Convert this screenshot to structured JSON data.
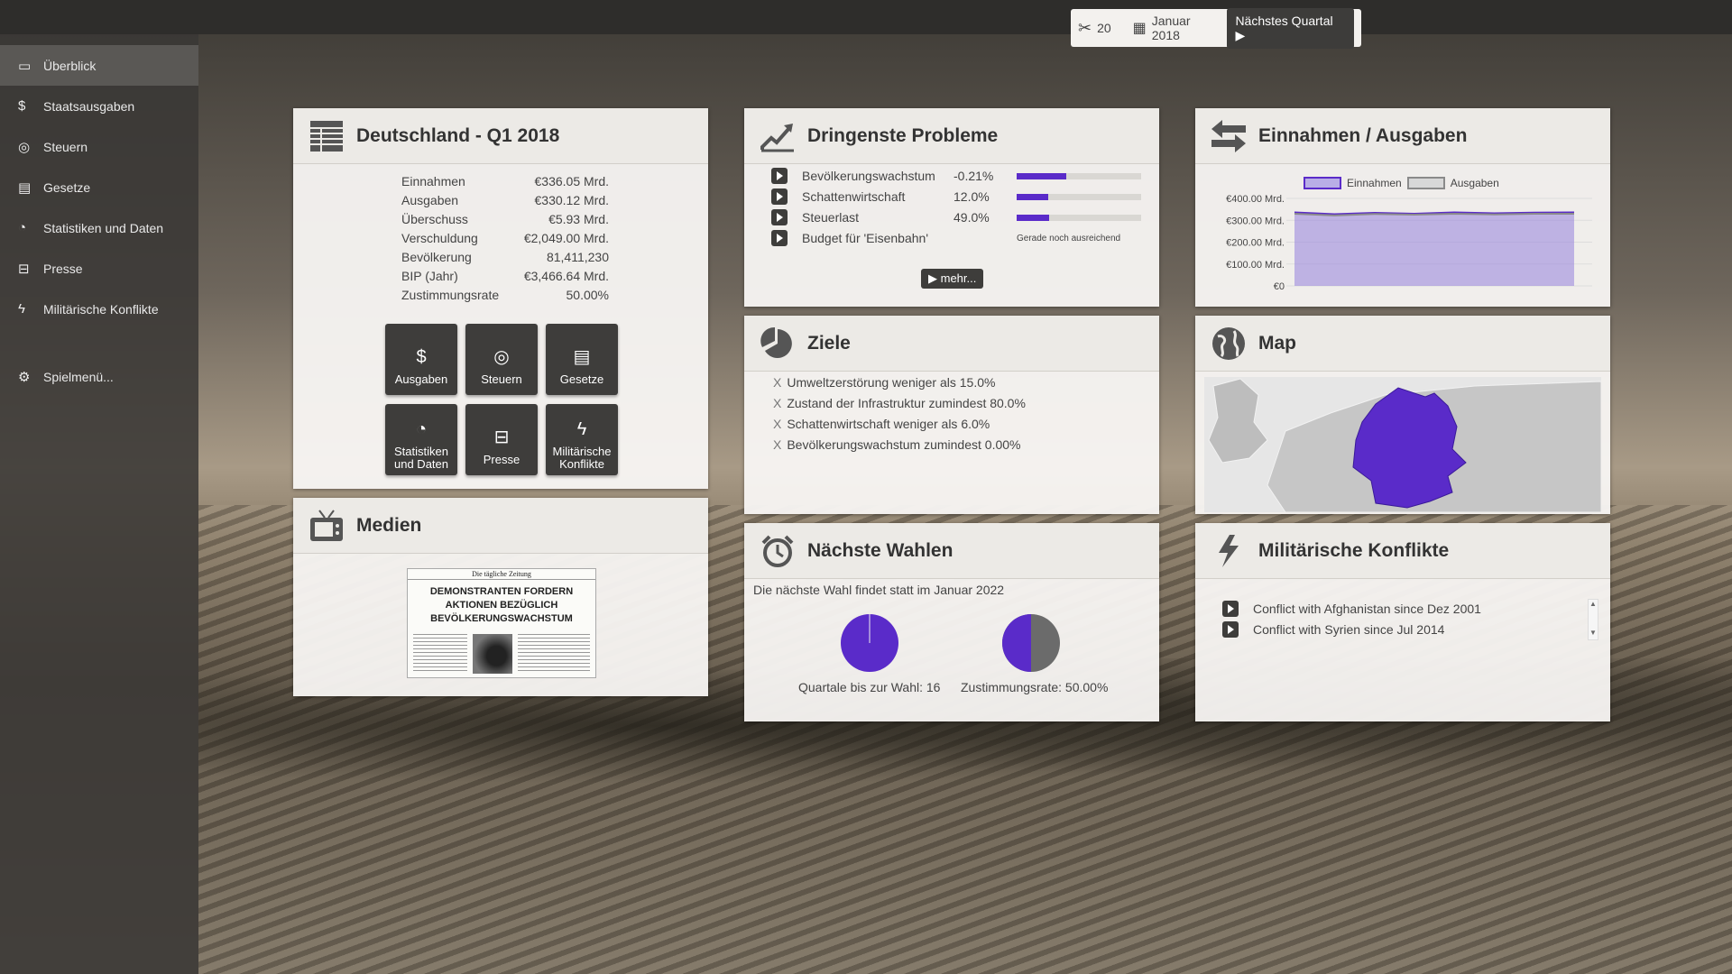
{
  "status": {
    "count": "20",
    "date": "Januar 2018",
    "next_label": "Nächstes Quartal"
  },
  "sidebar": {
    "items": [
      {
        "label": "Überblick",
        "icon": "monitor-icon"
      },
      {
        "label": "Staatsausgaben",
        "icon": "dollar-icon"
      },
      {
        "label": "Steuern",
        "icon": "coin-icon"
      },
      {
        "label": "Gesetze",
        "icon": "book-icon"
      },
      {
        "label": "Statistiken und Daten",
        "icon": "pie-icon"
      },
      {
        "label": "Presse",
        "icon": "newspaper-icon"
      },
      {
        "label": "Militärische Konflikte",
        "icon": "lightning-icon"
      }
    ],
    "menu_label": "Spielmenü..."
  },
  "country": {
    "title": "Deutschland - Q1 2018",
    "stats": [
      {
        "label": "Einnahmen",
        "value": "€336.05 Mrd."
      },
      {
        "label": "Ausgaben",
        "value": "€330.12 Mrd."
      },
      {
        "label": "Überschuss",
        "value": "€5.93 Mrd."
      },
      {
        "label": "Verschuldung",
        "value": "€2,049.00 Mrd."
      },
      {
        "label": "Bevölkerung",
        "value": "81,411,230"
      },
      {
        "label": "BIP (Jahr)",
        "value": "€3,466.64 Mrd."
      },
      {
        "label": "Zustimmungsrate",
        "value": "50.00%"
      }
    ],
    "tiles": {
      "ausgaben": "Ausgaben",
      "steuern": "Steuern",
      "gesetze": "Gesetze",
      "statistiken_1": "Statistiken",
      "statistiken_2": "und Daten",
      "presse": "Presse",
      "militaer_1": "Militärische",
      "militaer_2": "Konflikte"
    }
  },
  "problems": {
    "title": "Dringenste Probleme",
    "rows": [
      {
        "label": "Bevölkerungswachstum",
        "value": "-0.21%",
        "level": 0.4
      },
      {
        "label": "Schattenwirtschaft",
        "value": "12.0%",
        "level": 0.25
      },
      {
        "label": "Steuerlast",
        "value": "49.0%",
        "level": 0.26
      },
      {
        "label": "Budget für 'Eisenbahn'",
        "note": "Gerade noch ausreichend"
      }
    ],
    "more_label": "mehr..."
  },
  "finance": {
    "title": "Einnahmen / Ausgaben",
    "chart_data": {
      "type": "area",
      "series": [
        {
          "name": "Einnahmen",
          "values": [
            336,
            328,
            334,
            330,
            336,
            332,
            335,
            336
          ]
        },
        {
          "name": "Ausgaben",
          "values": [
            330,
            322,
            329,
            326,
            330,
            327,
            330,
            330
          ]
        }
      ],
      "yticks": [
        "€400.00 Mrd.",
        "€300.00 Mrd.",
        "€200.00 Mrd.",
        "€100.00 Mrd.",
        "€0"
      ],
      "ylim": [
        0,
        400
      ],
      "legend": "top",
      "colors": {
        "Einnahmen": "#5a2bc9",
        "Ausgaben": "#8a8a8a"
      }
    }
  },
  "goals": {
    "title": "Ziele",
    "items": [
      "Umweltzerstörung weniger als 15.0%",
      "Zustand der Infrastruktur zumindest 80.0%",
      "Schattenwirtschaft weniger als 6.0%",
      "Bevölkerungswachstum zumindest 0.00%"
    ],
    "mark": "X"
  },
  "map": {
    "title": "Map"
  },
  "media": {
    "title": "Medien",
    "paper_name": "Die tägliche Zeitung",
    "headline_1": "DEMONSTRANTEN FORDERN",
    "headline_2": "AKTIONEN BEZÜGLICH",
    "headline_3": "BEVÖLKERUNGSWACHSTUM"
  },
  "elections": {
    "title": "Nächste Wahlen",
    "info": "Die nächste Wahl findet statt im Januar 2022",
    "quarters_label": "Quartale bis zur Wahl: 16",
    "approval_label": "Zustimmungsrate: 50.00%",
    "quarters_fraction": 0.0,
    "approval_fraction": 0.5
  },
  "conflicts": {
    "title": "Militärische Konflikte",
    "items": [
      "Conflict with Afghanistan since Dez 2001",
      "Conflict with Syrien since Jul 2014"
    ]
  },
  "colors": {
    "accent": "#5a2bc9",
    "dark": "#3e3d3b"
  }
}
